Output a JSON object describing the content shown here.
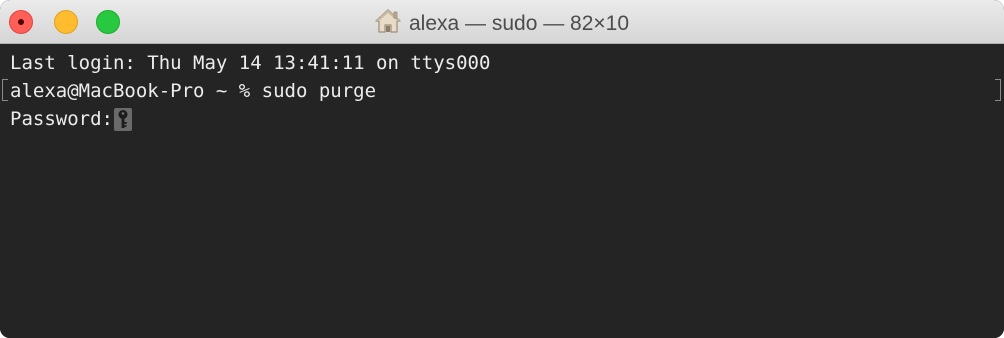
{
  "window": {
    "title": "alexa — sudo — 82×10",
    "title_icon": "home-icon"
  },
  "terminal": {
    "lines": [
      "Last login: Thu May 14 13:41:11 on ttys000",
      "alexa@MacBook-Pro ~ % sudo purge",
      "Password:"
    ],
    "cursor_icon": "key-icon"
  },
  "colors": {
    "background": "#242424",
    "text": "#ececec",
    "close": "#fe5f57",
    "minimize": "#febc2e",
    "maximize": "#28c840"
  }
}
